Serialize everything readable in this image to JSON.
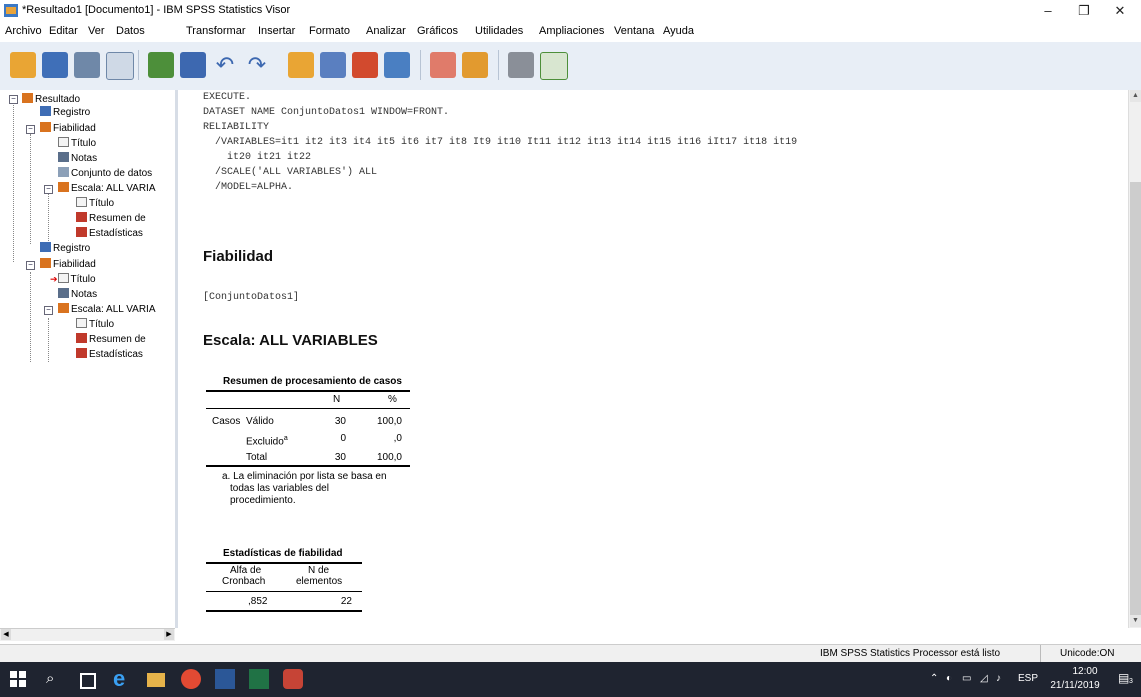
{
  "window": {
    "title": "*Resultado1 [Documento1] - IBM SPSS Statistics Visor",
    "minimize": "–",
    "maximize": "❐",
    "close": "✕"
  },
  "menu": [
    "Archivo",
    "Editar",
    "Ver",
    "Datos",
    "Transformar",
    "Insertar",
    "Formato",
    "Analizar",
    "Gráficos",
    "Utilidades",
    "Ampliaciones",
    "Ventana",
    "Ayuda"
  ],
  "toolbar": {
    "icons": [
      "open-icon",
      "save-icon",
      "print-icon",
      "print-preview-icon",
      "export-icon",
      "recall-dialog-icon",
      "undo-icon",
      "redo-icon",
      "goto-case-icon",
      "goto-variable-icon",
      "variables-icon",
      "create-variable-icon",
      "designate-window-icon",
      "insert-output-icon",
      "promote-icon",
      "select-last-output-icon"
    ]
  },
  "outline": {
    "items": [
      {
        "label": "Resultado",
        "level": 0,
        "icon": "output-icon"
      },
      {
        "label": "Registro",
        "level": 1,
        "icon": "log-icon"
      },
      {
        "label": "Fiabilidad",
        "level": 1,
        "icon": "output-icon"
      },
      {
        "label": "Título",
        "level": 2,
        "icon": "title-icon"
      },
      {
        "label": "Notas",
        "level": 2,
        "icon": "notes-icon"
      },
      {
        "label": "Conjunto de datos",
        "level": 2,
        "icon": "dataset-icon"
      },
      {
        "label": "Escala: ALL VARIA",
        "level": 2,
        "icon": "output-icon"
      },
      {
        "label": "Título",
        "level": 3,
        "icon": "title-icon"
      },
      {
        "label": "Resumen de",
        "level": 3,
        "icon": "table-icon"
      },
      {
        "label": "Estadísticas",
        "level": 3,
        "icon": "table-icon"
      },
      {
        "label": "Registro",
        "level": 1,
        "icon": "log-icon"
      },
      {
        "label": "Fiabilidad",
        "level": 1,
        "icon": "output-icon"
      },
      {
        "label": "Título",
        "level": 2,
        "icon": "title-icon",
        "selected": true
      },
      {
        "label": "Notas",
        "level": 2,
        "icon": "notes-icon"
      },
      {
        "label": "Escala: ALL VARIA",
        "level": 2,
        "icon": "output-icon"
      },
      {
        "label": "Título",
        "level": 3,
        "icon": "title-icon"
      },
      {
        "label": "Resumen de",
        "level": 3,
        "icon": "table-icon"
      },
      {
        "label": "Estadísticas",
        "level": 3,
        "icon": "table-icon"
      }
    ]
  },
  "syntax": {
    "lines": [
      "EXECUTE.",
      "DATASET NAME ConjuntoDatos1 WINDOW=FRONT.",
      "RELIABILITY",
      "  /VARIABLES=it1 it2 it3 it4 it5 it6 it7 it8 It9 it10 It11 it12 it13 it14 it15 it16 iIt17 it18 it19",
      "    it20 it21 it22",
      "  /SCALE('ALL VARIABLES') ALL",
      "  /MODEL=ALPHA."
    ]
  },
  "report": {
    "heading": "Fiabilidad",
    "dataset": "[ConjuntoDatos1]",
    "scale_heading": "Escala: ALL VARIABLES"
  },
  "case_table": {
    "title": "Resumen de procesamiento de casos",
    "col_n": "N",
    "col_pct": "%",
    "group": "Casos",
    "rows": [
      {
        "label": "Válido",
        "n": "30",
        "pct": "100,0"
      },
      {
        "label": "Excluido",
        "sup": "a",
        "n": "0",
        "pct": ",0"
      },
      {
        "label": "Total",
        "n": "30",
        "pct": "100,0"
      }
    ],
    "footnote": [
      "a. La eliminación por lista se basa en",
      "todas las variables del",
      "procedimiento."
    ]
  },
  "reliability_table": {
    "title": "Estadísticas de fiabilidad",
    "col1": [
      "Alfa de",
      "Cronbach"
    ],
    "col2": [
      "N de",
      "elementos"
    ],
    "alpha": ",852",
    "n_items": "22"
  },
  "status": {
    "processor": "IBM SPSS Statistics Processor está listo",
    "encoding": "Unicode:ON"
  },
  "taskbar": {
    "lang": "ESP",
    "time": "12:00",
    "date": "21/11/2019",
    "notifications": "3"
  }
}
